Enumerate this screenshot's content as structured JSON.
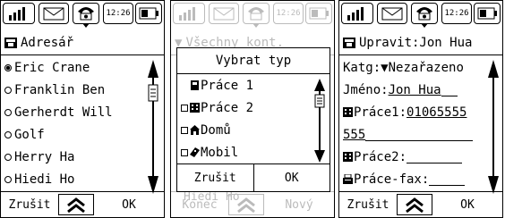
{
  "status": {
    "time": "12:26"
  },
  "panel1": {
    "title": "Adresář",
    "contacts": [
      "Eric Crane",
      "Franklin Ben",
      "Gerherdt Will",
      "Golf",
      "Herry Ha",
      "Hiedi Ho"
    ],
    "selected_index": 0,
    "left_soft": "Zrušit",
    "right_soft": "OK"
  },
  "panel2": {
    "bg_title": "Všechny kont.",
    "bg_row": "Hiedi Ho",
    "bg_left_soft": "Konec",
    "bg_right_soft": "Nový",
    "dialog_title": "Vybrat typ",
    "options": [
      {
        "label": "Práce 1",
        "icon": "phone-icon"
      },
      {
        "label": "Práce 2",
        "icon": "building-icon"
      },
      {
        "label": "Domů",
        "icon": "house-icon"
      },
      {
        "label": "Mobil",
        "icon": "mobile-icon"
      }
    ],
    "dialog_cancel": "Zrušit",
    "dialog_ok": "OK"
  },
  "panel3": {
    "title": "Upravit:Jon Hua",
    "category_label": "Katg:",
    "category_value": "Nezařazeno",
    "name_label": "Jméno:",
    "name_value": "Jon Hua",
    "work1_label": "Práce1:",
    "work1_value": "01065555",
    "work1_value_cont": "555",
    "work2_label": "Práce2:",
    "workfax_label": "Práce-fax:",
    "left_soft": "Zrušit",
    "right_soft": "OK"
  }
}
